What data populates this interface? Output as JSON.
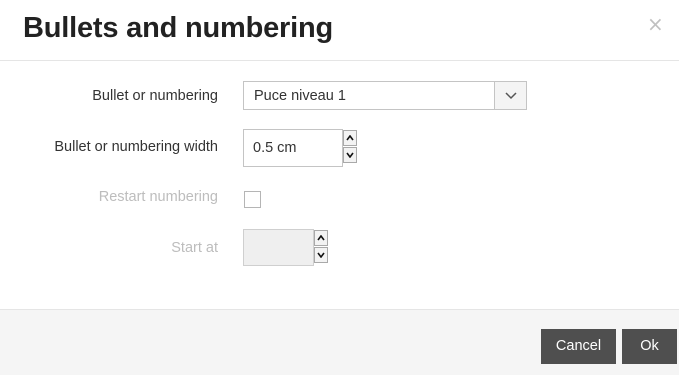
{
  "dialog": {
    "title": "Bullets and numbering",
    "close_icon": "close-icon",
    "close_glyph": "×"
  },
  "form": {
    "bullet_label": "Bullet or numbering",
    "bullet_value": "Puce niveau 1",
    "width_label": "Bullet or numbering width",
    "width_value": "0.5 cm",
    "restart_label": "Restart numbering",
    "restart_checked": false,
    "start_label": "Start at",
    "start_value": ""
  },
  "footer": {
    "cancel_label": "Cancel",
    "ok_label": "Ok"
  },
  "colors": {
    "button_bg": "#4f4f4f",
    "disabled_text": "#bdbdbd",
    "footer_bg": "#f5f5f5"
  }
}
